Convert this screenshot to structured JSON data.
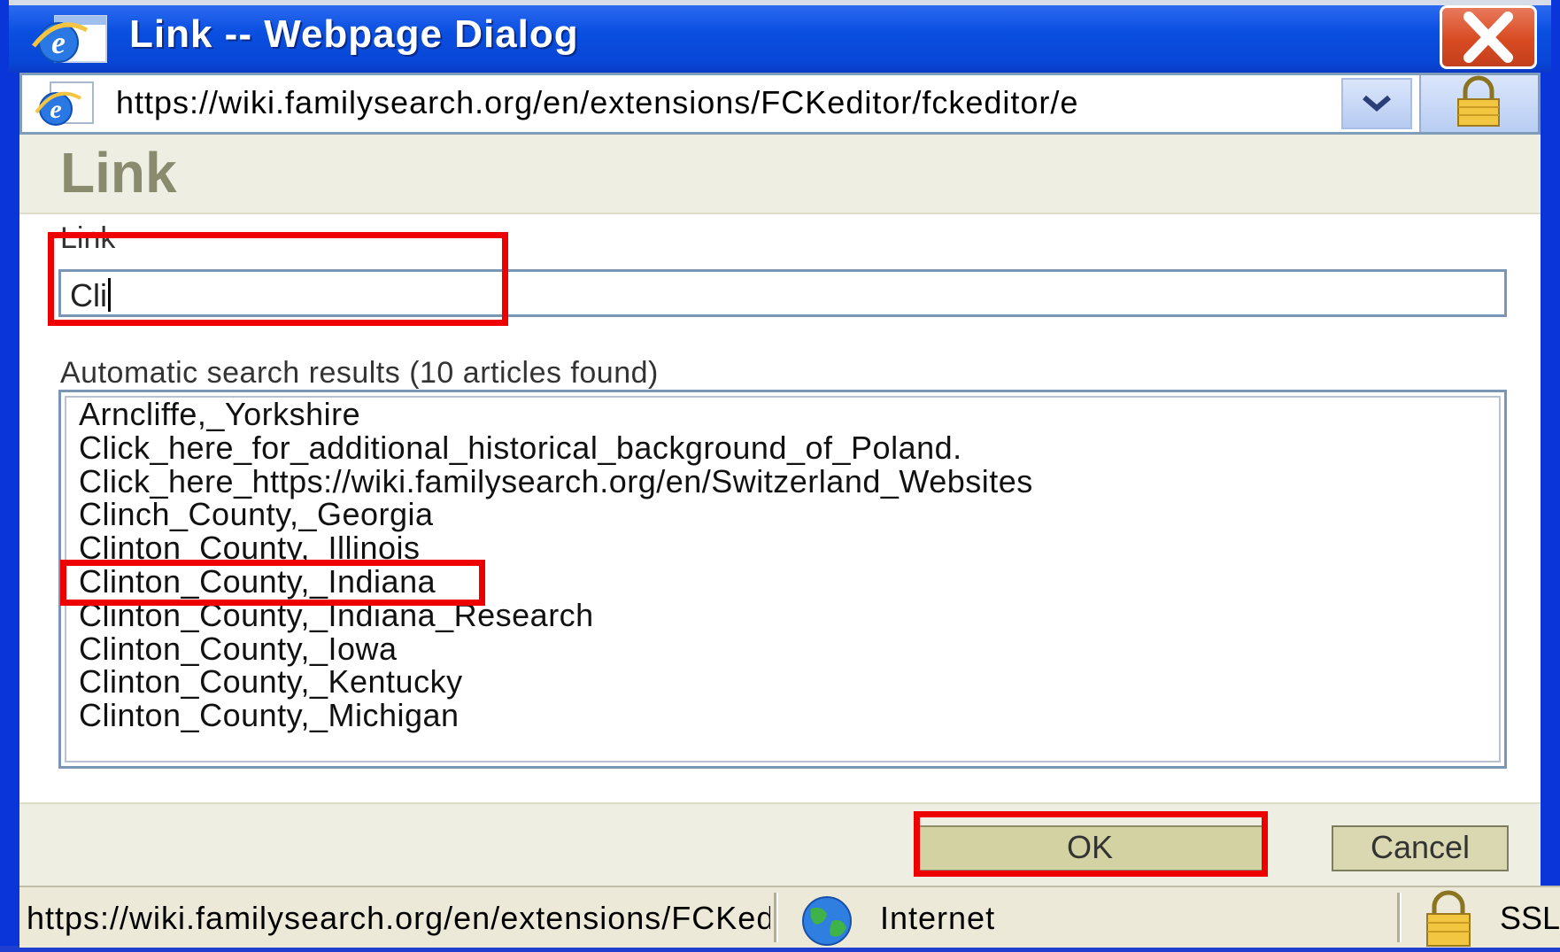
{
  "window": {
    "title": "Link -- Webpage Dialog",
    "address_url": "https://wiki.familysearch.org/en/extensions/FCKeditor/fckeditor/e",
    "accent_color": "#0a4fe0"
  },
  "dialog": {
    "heading": "Link",
    "link_label": "Link",
    "link_value": "Cli",
    "results_label": "Automatic search results (10 articles found)",
    "results": [
      "Arncliffe,_Yorkshire",
      "Click_here_for_additional_historical_background_of_Poland.",
      "Click_here_https://wiki.familysearch.org/en/Switzerland_Websites",
      "Clinch_County,_Georgia",
      "Clinton_County,_Illinois",
      "Clinton_County,_Indiana",
      "Clinton_County,_Indiana_Research",
      "Clinton_County,_Iowa",
      "Clinton_County,_Kentucky",
      "Clinton_County,_Michigan"
    ],
    "ok_label": "OK",
    "cancel_label": "Cancel",
    "highlight_color": "#ee0000"
  },
  "statusbar": {
    "url": "https://wiki.familysearch.org/en/extensions/FCKeditor",
    "zone": "Internet",
    "ssl": "SSL"
  },
  "icons": [
    "ie-icon",
    "close-icon",
    "chevron-down-icon",
    "lock-icon",
    "globe-icon"
  ]
}
